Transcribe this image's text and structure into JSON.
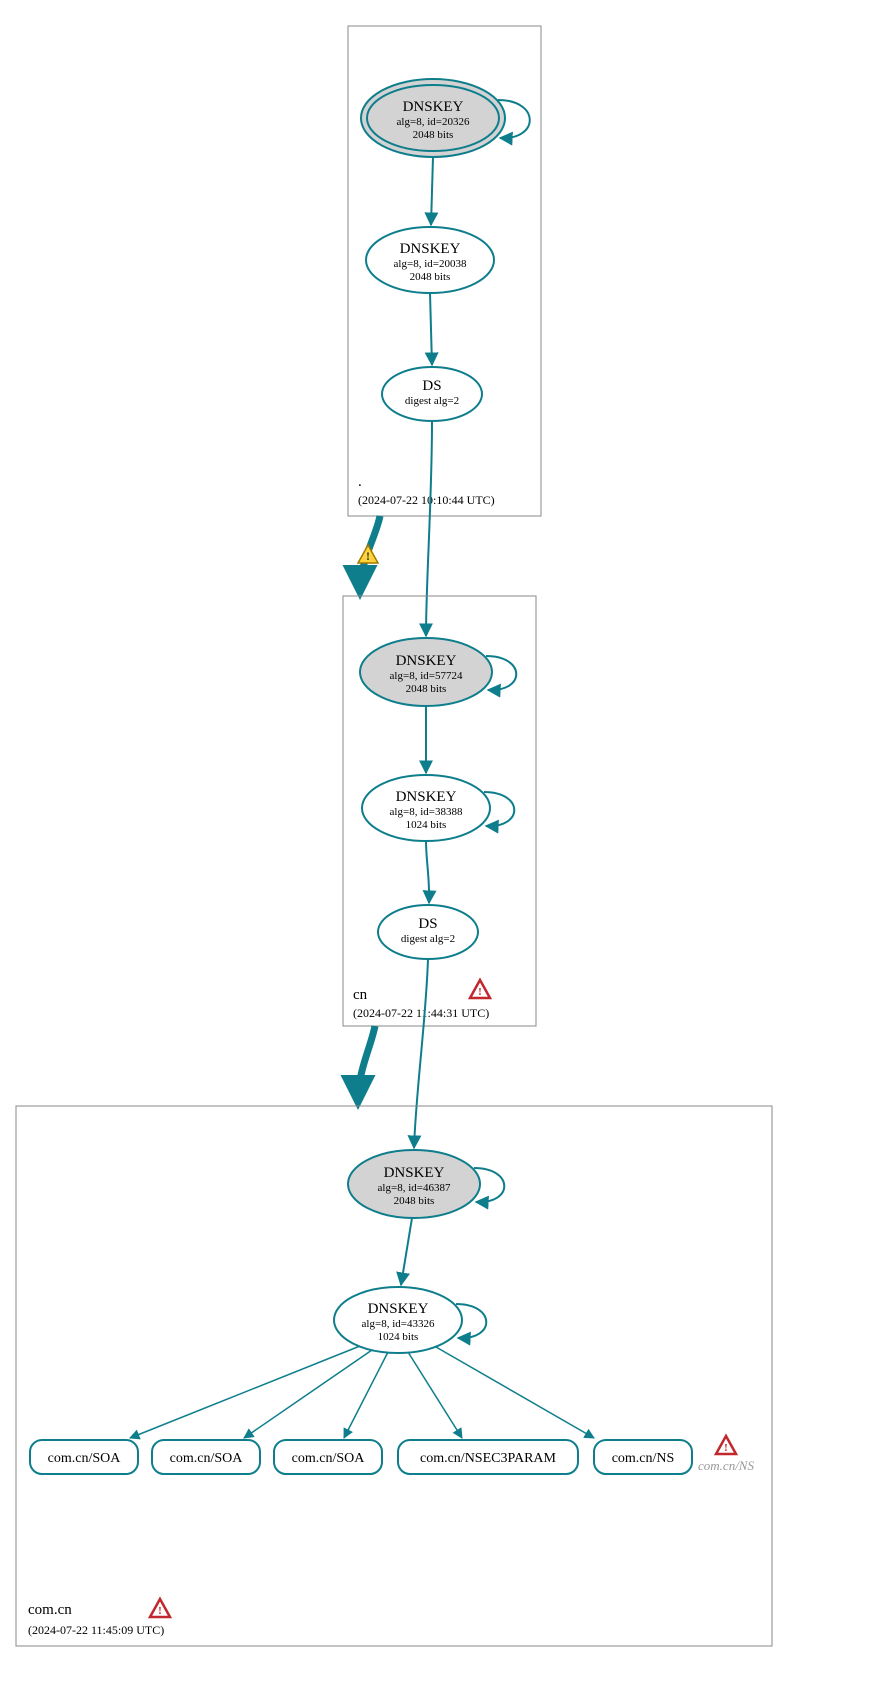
{
  "colors": {
    "stroke": "#0e7e8c",
    "node_fill_grey": "#d3d3d3",
    "node_fill_white": "#ffffff",
    "zone_box": "#888888",
    "warn_fill": "#ffd33a",
    "warn_stroke": "#a07a00",
    "err_fill": "#ffffff",
    "err_stroke": "#c1272d"
  },
  "zones": {
    "root": {
      "label": ".",
      "timestamp": "(2024-07-22 10:10:44 UTC)",
      "ksk": {
        "title": "DNSKEY",
        "line1": "alg=8, id=20326",
        "line2": "2048 bits"
      },
      "zsk": {
        "title": "DNSKEY",
        "line1": "alg=8, id=20038",
        "line2": "2048 bits"
      },
      "ds": {
        "title": "DS",
        "line1": "digest alg=2"
      }
    },
    "cn": {
      "label": "cn",
      "timestamp": "(2024-07-22 11:44:31 UTC)",
      "ksk": {
        "title": "DNSKEY",
        "line1": "alg=8, id=57724",
        "line2": "2048 bits"
      },
      "zsk": {
        "title": "DNSKEY",
        "line1": "alg=8, id=38388",
        "line2": "1024 bits"
      },
      "ds": {
        "title": "DS",
        "line1": "digest alg=2"
      }
    },
    "comcn": {
      "label": "com.cn",
      "timestamp": "(2024-07-22 11:45:09 UTC)",
      "ksk": {
        "title": "DNSKEY",
        "line1": "alg=8, id=46387",
        "line2": "2048 bits"
      },
      "zsk": {
        "title": "DNSKEY",
        "line1": "alg=8, id=43326",
        "line2": "1024 bits"
      },
      "rr": {
        "soa1": "com.cn/SOA",
        "soa2": "com.cn/SOA",
        "soa3": "com.cn/SOA",
        "nsec3": "com.cn/NSEC3PARAM",
        "ns": "com.cn/NS"
      },
      "ghost_ns": "com.cn/NS"
    }
  }
}
